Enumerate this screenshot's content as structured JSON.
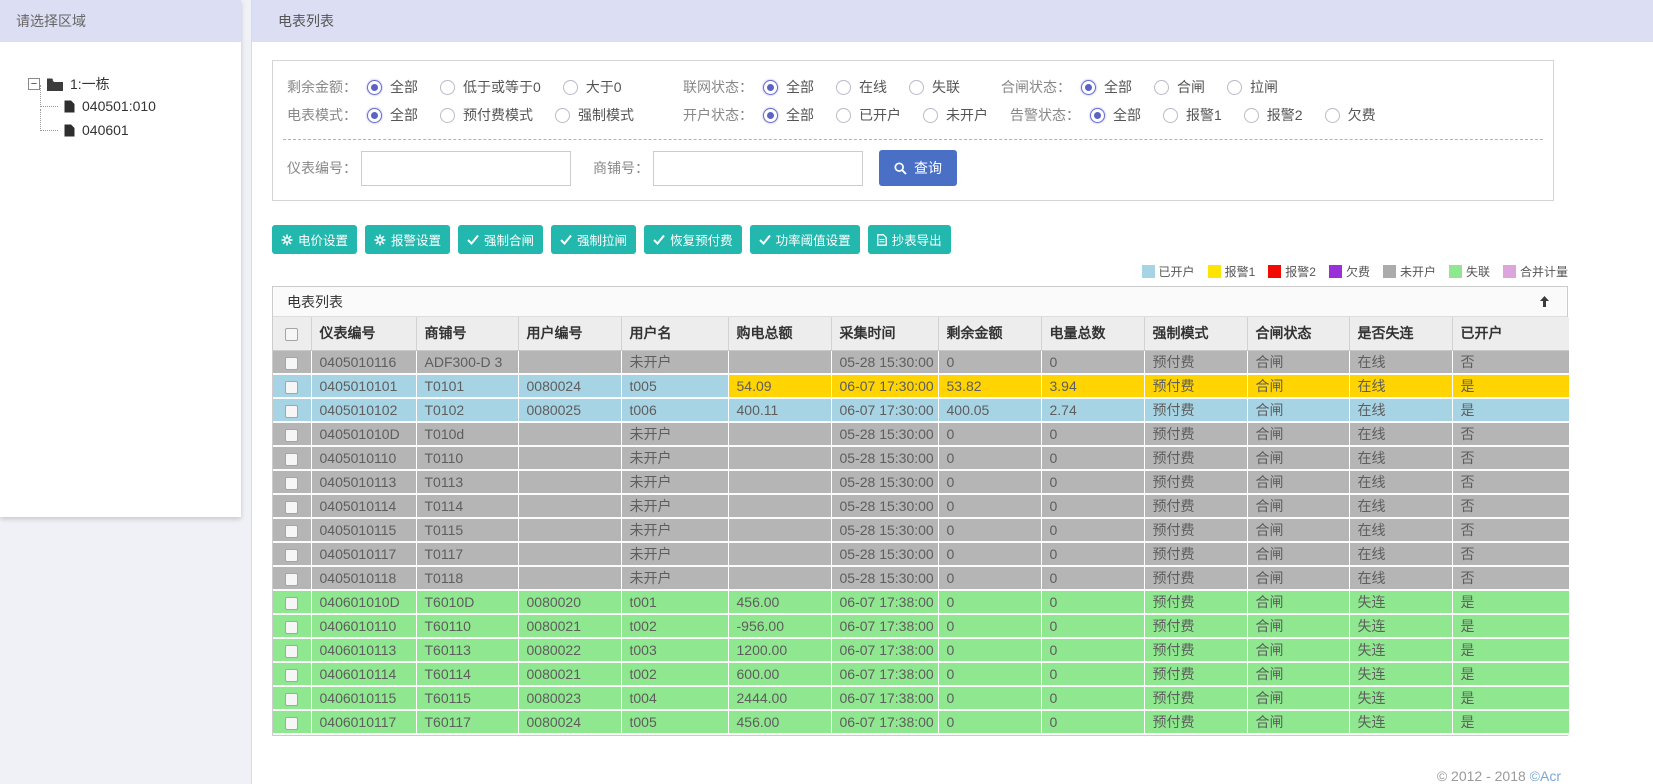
{
  "sidebar": {
    "title": "请选择区域",
    "tree": {
      "root_label": "1:一栋",
      "children": [
        "040501:010",
        "040601"
      ]
    }
  },
  "header": {
    "title": "电表列表"
  },
  "filters": {
    "rows": [
      [
        {
          "name": "remaining-amount",
          "label": "剩余金额：",
          "options": [
            "全部",
            "低于或等于0",
            "大于0"
          ],
          "selected": 0
        },
        {
          "name": "network-status",
          "label": "联网状态：",
          "options": [
            "全部",
            "在线",
            "失联"
          ],
          "selected": 0
        },
        {
          "name": "switch-status",
          "label": "合闸状态：",
          "options": [
            "全部",
            "合闸",
            "拉闸"
          ],
          "selected": 0
        }
      ],
      [
        {
          "name": "meter-mode",
          "label": "电表模式：",
          "options": [
            "全部",
            "预付费模式",
            "强制模式"
          ],
          "selected": 0
        },
        {
          "name": "account-status",
          "label": "开户状态：",
          "options": [
            "全部",
            "已开户",
            "未开户"
          ],
          "selected": 0
        },
        {
          "name": "alarm-status",
          "label": "告警状态：",
          "options": [
            "全部",
            "报警1",
            "报警2",
            "欠费"
          ],
          "selected": 0
        }
      ]
    ],
    "search": {
      "meter_label": "仪表编号：",
      "meter_value": "",
      "shop_label": "商铺号：",
      "shop_value": "",
      "query_label": "查询"
    }
  },
  "actions": [
    {
      "name": "price-setting-button",
      "label": "电价设置",
      "icon": "gear-icon"
    },
    {
      "name": "alarm-setting-button",
      "label": "报警设置",
      "icon": "gear-icon"
    },
    {
      "name": "force-close-switch-button",
      "label": "强制合闸",
      "icon": "check-icon"
    },
    {
      "name": "force-trip-switch-button",
      "label": "强制拉闸",
      "icon": "check-icon"
    },
    {
      "name": "restore-prepaid-button",
      "label": "恢复预付费",
      "icon": "check-icon"
    },
    {
      "name": "power-threshold-button",
      "label": "功率阈值设置",
      "icon": "check-icon"
    },
    {
      "name": "meter-export-button",
      "label": "抄表导出",
      "icon": "document-icon"
    }
  ],
  "legend": [
    {
      "label": "已开户",
      "color": "#a6d4e4"
    },
    {
      "label": "报警1",
      "color": "#ffe400"
    },
    {
      "label": "报警2",
      "color": "#f00c00"
    },
    {
      "label": "欠费",
      "color": "#9a30d8"
    },
    {
      "label": "未开户",
      "color": "#ababab"
    },
    {
      "label": "失联",
      "color": "#8fe78f"
    },
    {
      "label": "合并计量",
      "color": "#dca6dc"
    }
  ],
  "table": {
    "panel_title": "电表列表",
    "columns": [
      "仪表编号",
      "商铺号",
      "用户编号",
      "用户名",
      "购电总额",
      "采集时间",
      "剩余金额",
      "电量总数",
      "强制模式",
      "合闸状态",
      "是否失连",
      "已开户"
    ],
    "row_colors": {
      "gray": "#b5b5b5",
      "blue": "#a6d4e4",
      "green": "#8fe78f",
      "yellow": "#ffd400"
    },
    "rows": [
      {
        "color": "gray",
        "cells": [
          "0405010116",
          "ADF300-D 3",
          "",
          "未开户",
          "",
          "05-28 15:30:00",
          "0",
          "0",
          "预付费",
          "合闸",
          "在线",
          "否"
        ]
      },
      {
        "color": "blue",
        "yellow_from": 4,
        "cells": [
          "0405010101",
          "T0101",
          "0080024",
          "t005",
          "54.09",
          "06-07 17:30:00",
          "53.82",
          "3.94",
          "预付费",
          "合闸",
          "在线",
          "是"
        ]
      },
      {
        "color": "blue",
        "cells": [
          "0405010102",
          "T0102",
          "0080025",
          "t006",
          "400.11",
          "06-07 17:30:00",
          "400.05",
          "2.74",
          "预付费",
          "合闸",
          "在线",
          "是"
        ]
      },
      {
        "color": "gray",
        "cells": [
          "040501010D",
          "T010d",
          "",
          "未开户",
          "",
          "05-28 15:30:00",
          "0",
          "0",
          "预付费",
          "合闸",
          "在线",
          "否"
        ]
      },
      {
        "color": "gray",
        "cells": [
          "0405010110",
          "T0110",
          "",
          "未开户",
          "",
          "05-28 15:30:00",
          "0",
          "0",
          "预付费",
          "合闸",
          "在线",
          "否"
        ]
      },
      {
        "color": "gray",
        "cells": [
          "0405010113",
          "T0113",
          "",
          "未开户",
          "",
          "05-28 15:30:00",
          "0",
          "0",
          "预付费",
          "合闸",
          "在线",
          "否"
        ]
      },
      {
        "color": "gray",
        "cells": [
          "0405010114",
          "T0114",
          "",
          "未开户",
          "",
          "05-28 15:30:00",
          "0",
          "0",
          "预付费",
          "合闸",
          "在线",
          "否"
        ]
      },
      {
        "color": "gray",
        "cells": [
          "0405010115",
          "T0115",
          "",
          "未开户",
          "",
          "05-28 15:30:00",
          "0",
          "0",
          "预付费",
          "合闸",
          "在线",
          "否"
        ]
      },
      {
        "color": "gray",
        "cells": [
          "0405010117",
          "T0117",
          "",
          "未开户",
          "",
          "05-28 15:30:00",
          "0",
          "0",
          "预付费",
          "合闸",
          "在线",
          "否"
        ]
      },
      {
        "color": "gray",
        "cells": [
          "0405010118",
          "T0118",
          "",
          "未开户",
          "",
          "05-28 15:30:00",
          "0",
          "0",
          "预付费",
          "合闸",
          "在线",
          "否"
        ]
      },
      {
        "color": "green",
        "cells": [
          "040601010D",
          "T6010D",
          "0080020",
          "t001",
          "456.00",
          "06-07 17:38:00",
          "0",
          "0",
          "预付费",
          "合闸",
          "失连",
          "是"
        ]
      },
      {
        "color": "green",
        "cells": [
          "0406010110",
          "T60110",
          "0080021",
          "t002",
          "-956.00",
          "06-07 17:38:00",
          "0",
          "0",
          "预付费",
          "合闸",
          "失连",
          "是"
        ]
      },
      {
        "color": "green",
        "cells": [
          "0406010113",
          "T60113",
          "0080022",
          "t003",
          "1200.00",
          "06-07 17:38:00",
          "0",
          "0",
          "预付费",
          "合闸",
          "失连",
          "是"
        ]
      },
      {
        "color": "green",
        "cells": [
          "0406010114",
          "T60114",
          "0080021",
          "t002",
          "600.00",
          "06-07 17:38:00",
          "0",
          "0",
          "预付费",
          "合闸",
          "失连",
          "是"
        ]
      },
      {
        "color": "green",
        "cells": [
          "0406010115",
          "T60115",
          "0080023",
          "t004",
          "2444.00",
          "06-07 17:38:00",
          "0",
          "0",
          "预付费",
          "合闸",
          "失连",
          "是"
        ]
      },
      {
        "color": "green",
        "cells": [
          "0406010117",
          "T60117",
          "0080024",
          "t005",
          "456.00",
          "06-07 17:38:00",
          "0",
          "0",
          "预付费",
          "合闸",
          "失连",
          "是"
        ]
      }
    ]
  },
  "footer": {
    "copyright": "© 2012 - 2018 ",
    "brand": "©Acr"
  }
}
